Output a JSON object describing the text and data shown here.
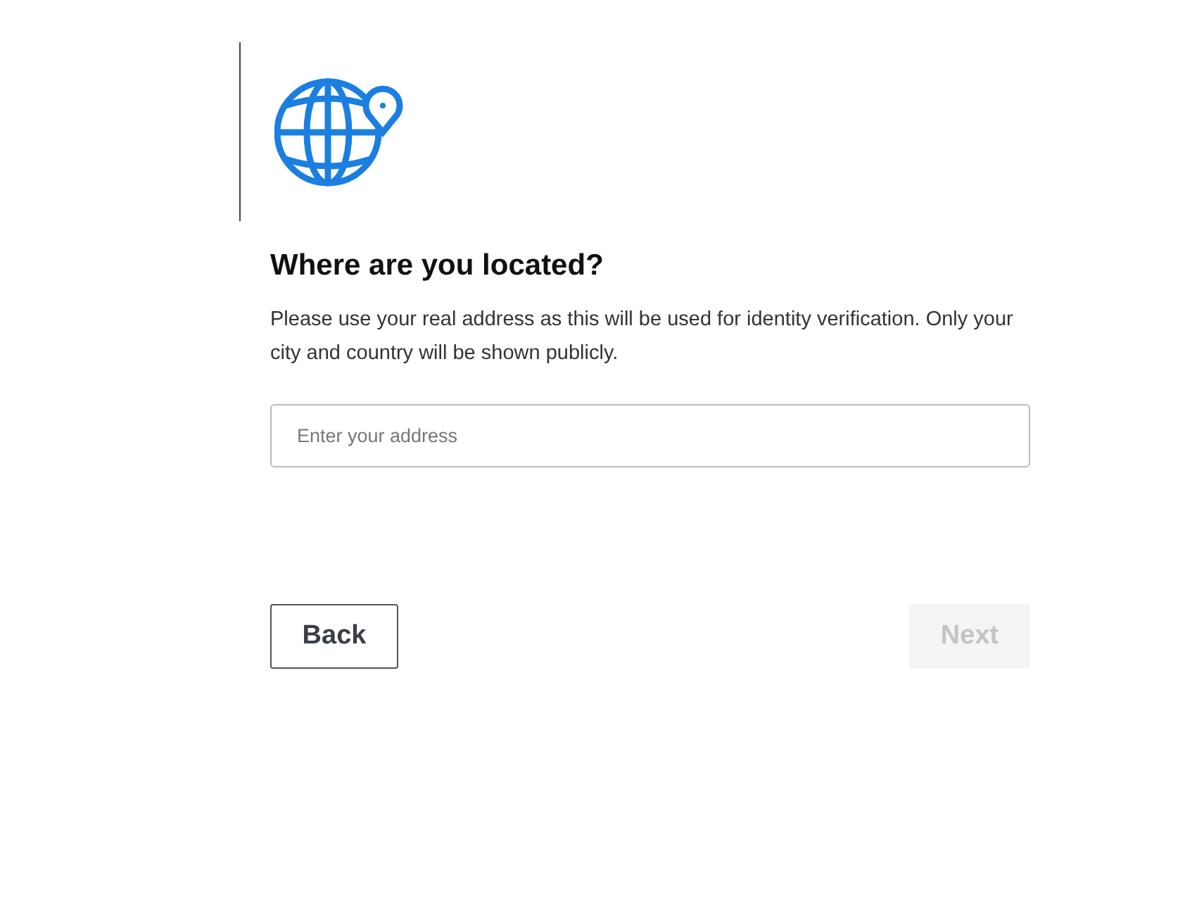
{
  "title": "Where are you located?",
  "description": "Please use your real address as this will be used for identity verification. Only your city and country will be shown publicly.",
  "address_field": {
    "placeholder": "Enter your address"
  },
  "buttons": [
    {
      "label": "Back",
      "disabled": false
    },
    {
      "label": "Next",
      "disabled": true
    }
  ]
}
